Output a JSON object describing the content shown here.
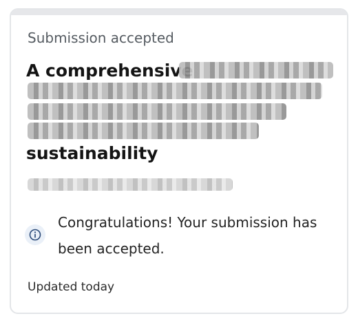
{
  "card": {
    "status_label": "Submission accepted",
    "title_first": "A comprehensive",
    "title_last": "sustainability",
    "notice": {
      "icon": "info-icon",
      "message": "Congratulations! Your submission has been accepted."
    },
    "updated": "Updated today"
  },
  "colors": {
    "card_border": "#e3e5e8",
    "status_text": "#555b61",
    "info_icon_bg": "#eaf0f8",
    "info_icon_stroke": "#2b4a78"
  }
}
